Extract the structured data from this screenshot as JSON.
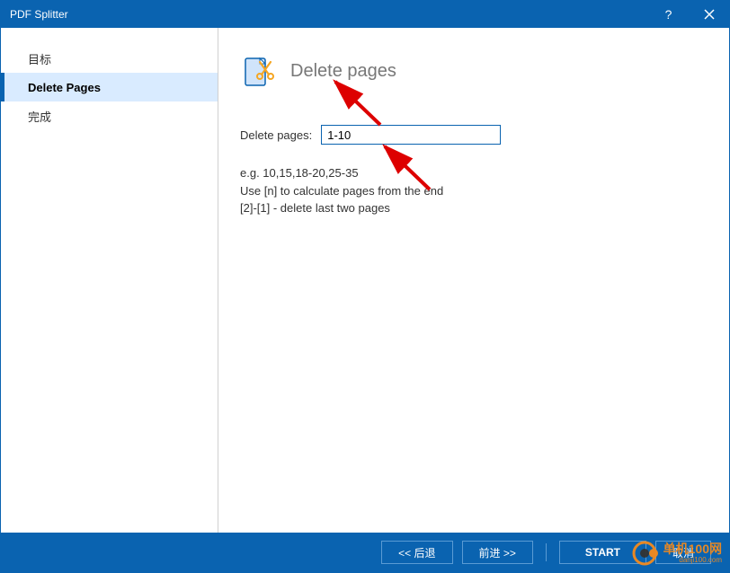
{
  "titlebar": {
    "title": "PDF Splitter"
  },
  "sidebar": {
    "items": [
      {
        "label": "目标",
        "active": false
      },
      {
        "label": "Delete Pages",
        "active": true
      },
      {
        "label": "完成",
        "active": false
      }
    ]
  },
  "content": {
    "header_title": "Delete pages",
    "form_label": "Delete pages:",
    "form_value": "1-10",
    "hint": "e.g. 10,15,18-20,25-35\nUse [n] to calculate pages from the end\n[2]-[1] - delete last two pages"
  },
  "footer": {
    "back": "<< 后退",
    "forward": "前进 >>",
    "start": "START",
    "cancel": "取消"
  },
  "watermark": {
    "main": "单机100网",
    "sub": "danji100.com"
  }
}
